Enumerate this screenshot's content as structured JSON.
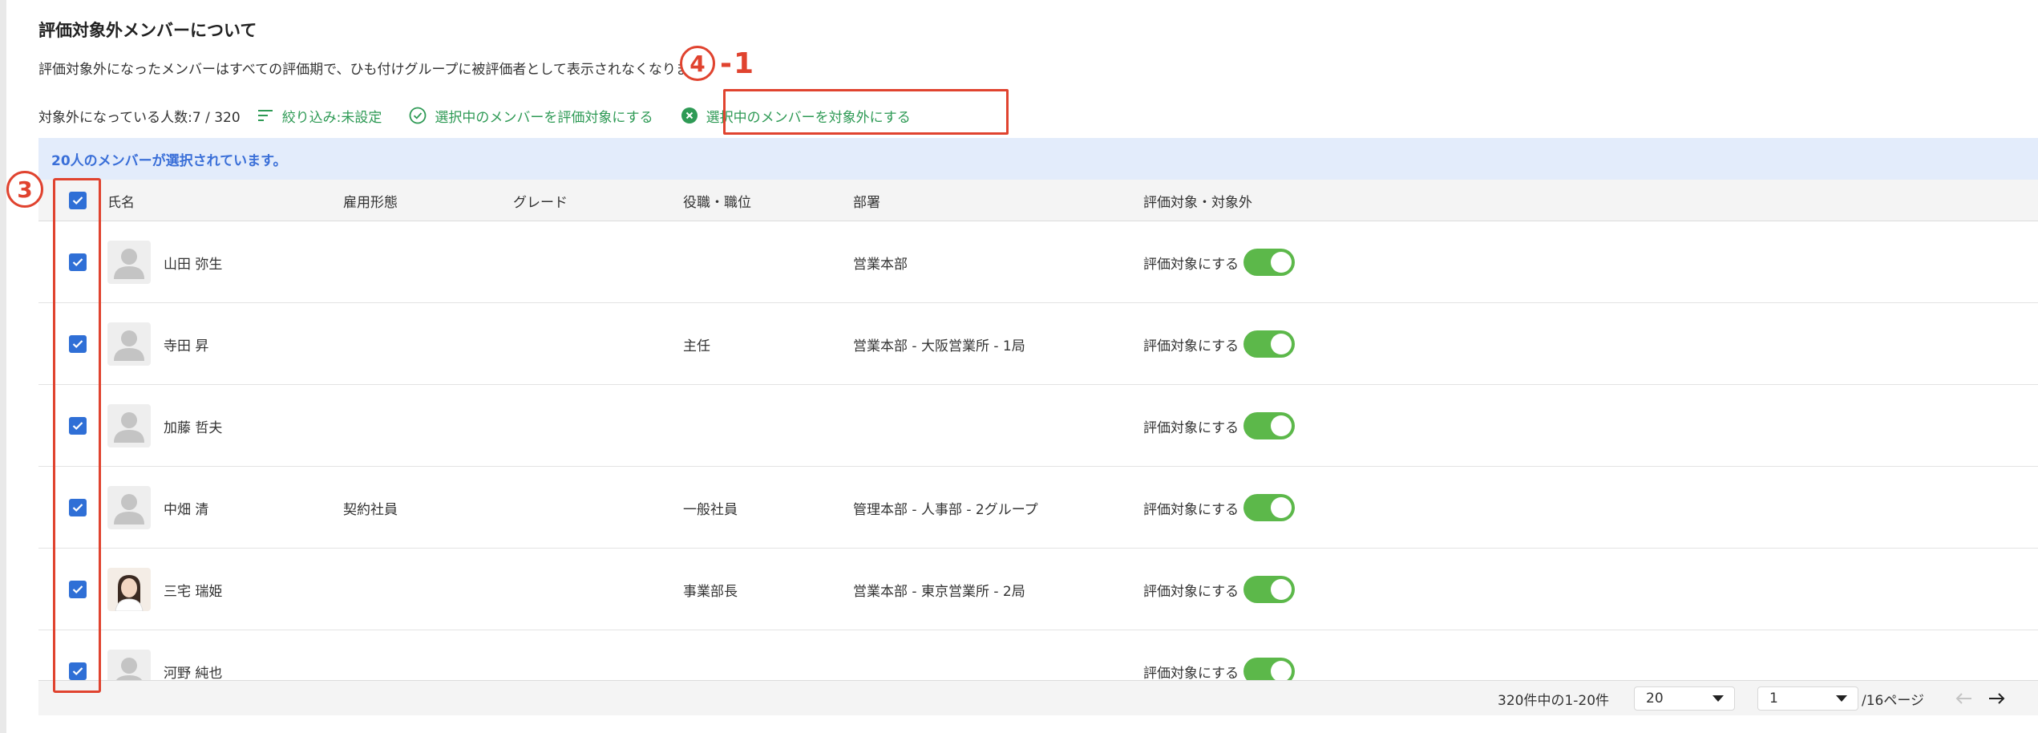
{
  "section": {
    "title": "評価対象外メンバーについて",
    "description": "評価対象外になったメンバーはすべての評価期で、ひも付けグループに被評価者として表示されなくなります。"
  },
  "toolbar": {
    "count_label": "対象外になっている人数:7 / 320",
    "filter_label": "絞り込み:未設定",
    "include_label": "選択中のメンバーを評価対象にする",
    "exclude_label": "選択中のメンバーを対象外にする",
    "accent_color": "#2e9a55"
  },
  "annotations": {
    "callout_4_circle": "4",
    "callout_4_suffix": "-1",
    "callout_3": "3",
    "highlight_color": "#e0432f"
  },
  "selection_banner": "20人のメンバーが選択されています。",
  "table": {
    "headers": {
      "name": "氏名",
      "employment": "雇用形態",
      "grade": "グレード",
      "position": "役職・職位",
      "department": "部署",
      "evaluation": "評価対象・対象外"
    },
    "rows": [
      {
        "name": "山田 弥生",
        "employment": "",
        "grade": "",
        "position": "",
        "department": "営業本部",
        "toggle_label": "評価対象にする",
        "avatar": "default-avatar",
        "checked": true,
        "toggle_on": true
      },
      {
        "name": "寺田 昇",
        "employment": "",
        "grade": "",
        "position": "主任",
        "department": "営業本部 - 大阪営業所 - 1局",
        "toggle_label": "評価対象にする",
        "avatar": "default-avatar",
        "checked": true,
        "toggle_on": true
      },
      {
        "name": "加藤 哲夫",
        "employment": "",
        "grade": "",
        "position": "",
        "department": "",
        "toggle_label": "評価対象にする",
        "avatar": "default-avatar",
        "checked": true,
        "toggle_on": true
      },
      {
        "name": "中畑 清",
        "employment": "契約社員",
        "grade": "",
        "position": "一般社員",
        "department": "管理本部 - 人事部 - 2グループ",
        "toggle_label": "評価対象にする",
        "avatar": "default-avatar",
        "checked": true,
        "toggle_on": true
      },
      {
        "name": "三宅 瑞姫",
        "employment": "",
        "grade": "",
        "position": "事業部長",
        "department": "営業本部 - 東京営業所 - 2局",
        "toggle_label": "評価対象にする",
        "avatar": "photo-avatar",
        "checked": true,
        "toggle_on": true
      },
      {
        "name": "河野 純也",
        "employment": "",
        "grade": "",
        "position": "",
        "department": "",
        "toggle_label": "評価対象にする",
        "avatar": "default-avatar",
        "checked": true,
        "toggle_on": true
      }
    ]
  },
  "pagination": {
    "summary": "320件中の1-20件",
    "per_page": "20",
    "current_page": "1",
    "total_pages_label": "/16ページ"
  }
}
